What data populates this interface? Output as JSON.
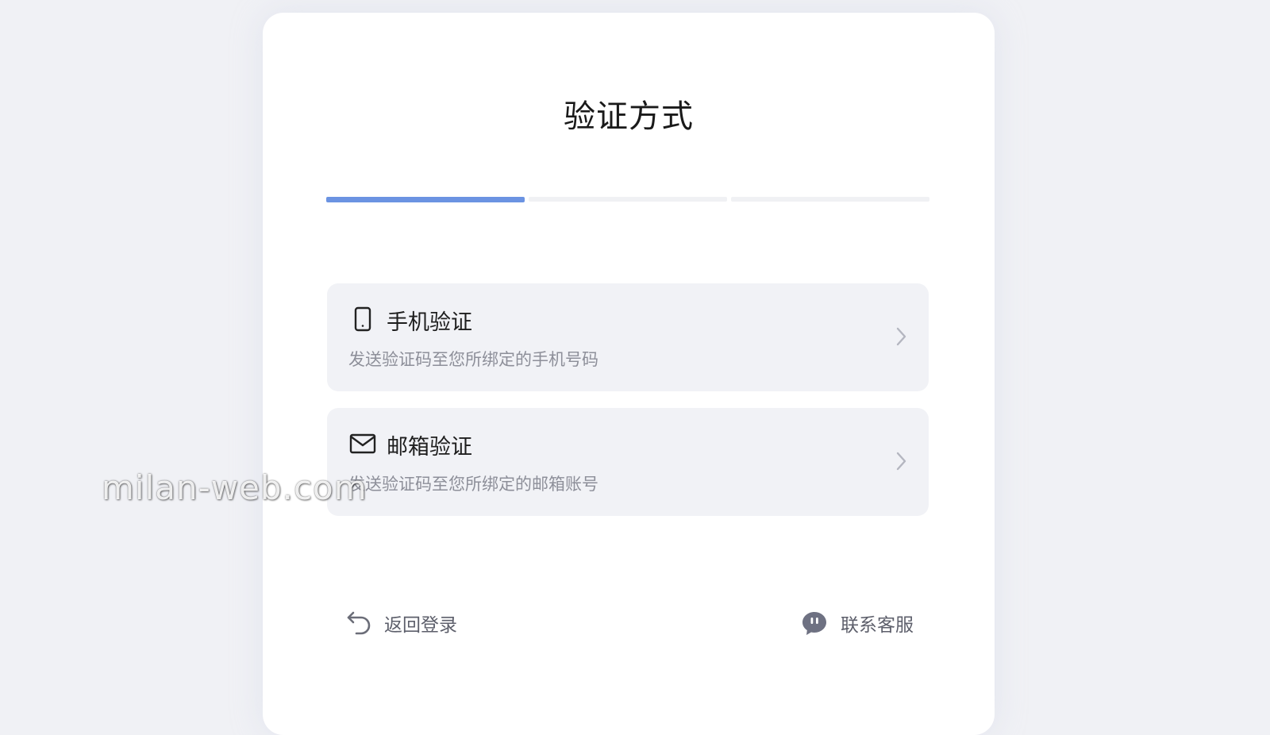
{
  "page": {
    "title": "验证方式"
  },
  "progress": {
    "steps_total": 3,
    "current_step": 1,
    "active_color": "#6b93e2"
  },
  "options": [
    {
      "title": "手机验证",
      "description": "发送验证码至您所绑定的手机号码",
      "icon": "phone-icon"
    },
    {
      "title": "邮箱验证",
      "description": "发送验证码至您所绑定的邮箱账号",
      "icon": "mail-icon"
    }
  ],
  "footer": {
    "back_label": "返回登录",
    "back_icon": "undo-arrow-icon",
    "support_label": "联系客服",
    "support_icon": "chat-bubble-icon"
  },
  "watermark": {
    "text": "milan-web.com"
  }
}
